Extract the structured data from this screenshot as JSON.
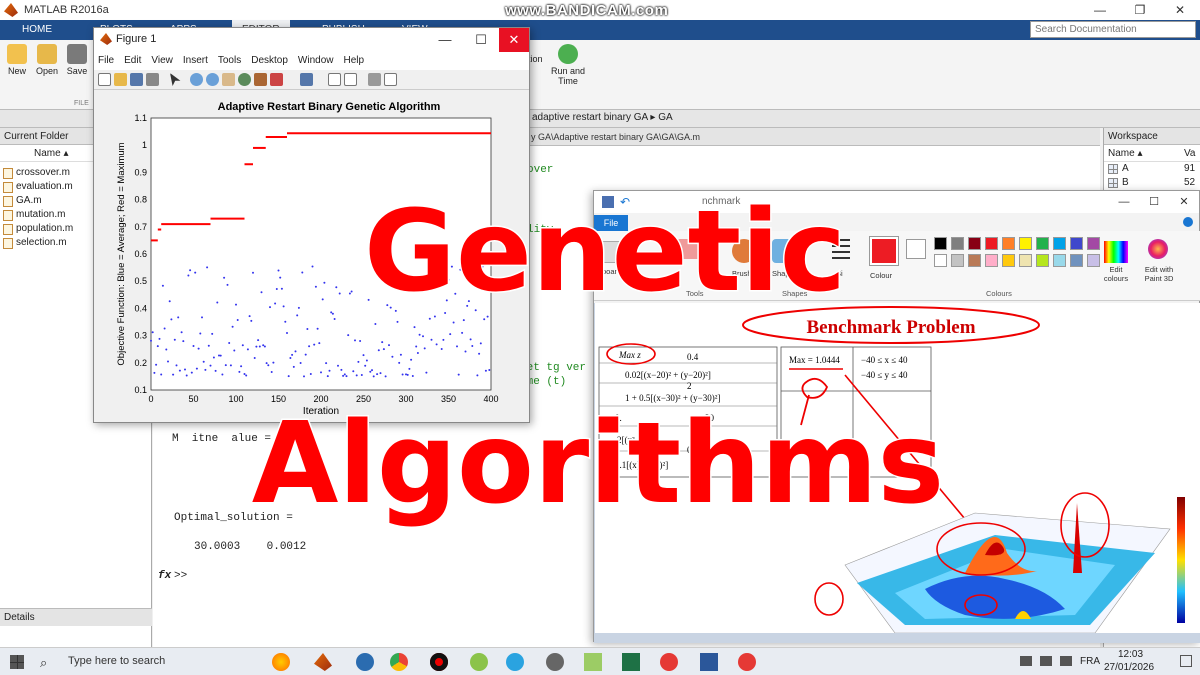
{
  "matlab": {
    "window_title": "MATLAB R2016a",
    "recorder_watermark": "www.BANDICAM.com",
    "tabs": [
      "HOME",
      "PLOTS",
      "APPS",
      "EDITOR",
      "PUBLISH",
      "VIEW"
    ],
    "search_placeholder": "Search Documentation",
    "ribbon": {
      "new": "New",
      "open": "Open",
      "save": "Save",
      "file_section": "FILE",
      "run_and_time": "Run and Time",
      "run_section": "tion"
    },
    "address_path": "adaptive restart binary GA ▸ GA",
    "editor_path": "y GA\\Adaptive restart binary GA\\GA\\GA.m",
    "current_folder": {
      "title": "Current Folder",
      "column": "Name ▴",
      "files": [
        "crossover.m",
        "evaluation.m",
        "GA.m",
        "mutation.m",
        "population.m",
        "selection.m"
      ],
      "details": "Details"
    },
    "workspace": {
      "title": "Workspace",
      "col_name": "Name ▴",
      "col_value": "Va",
      "rows": [
        {
          "name": "A",
          "value": "91"
        },
        {
          "name": "B",
          "value": "52"
        }
      ]
    },
    "command": {
      "line1": "over",
      "line2": "lity",
      "line3": "set tg ver",
      "line4": "ime (t)",
      "line5": "M  itne  alue =",
      "line6": "Optimal_solution =",
      "line7": "30.0003    0.0012",
      "prompt_fx": "fx",
      "prompt": ">>"
    }
  },
  "figure1": {
    "title": "Figure 1",
    "menu": [
      "File",
      "Edit",
      "View",
      "Insert",
      "Tools",
      "Desktop",
      "Window",
      "Help"
    ]
  },
  "chart_data": {
    "type": "scatter",
    "title": "Adaptive Restart Binary Genetic Algorithm",
    "xlabel": "Iteration",
    "ylabel": "Objective Function: Blue = Average; Red = Maximum",
    "xlim": [
      0,
      400
    ],
    "ylim": [
      0.1,
      1.1
    ],
    "x_ticks": [
      0,
      50,
      100,
      150,
      200,
      250,
      300,
      350,
      400
    ],
    "y_ticks": [
      0.1,
      0.2,
      0.3,
      0.4,
      0.5,
      0.6,
      0.7,
      0.8,
      0.9,
      1,
      1.1
    ],
    "series": [
      {
        "name": "Maximum",
        "color": "#ff0000",
        "segments": [
          {
            "x_from": 0,
            "x_to": 8,
            "y": 0.65
          },
          {
            "x_from": 8,
            "x_to": 12,
            "y": 0.69
          },
          {
            "x_from": 12,
            "x_to": 70,
            "y": 0.71
          },
          {
            "x_from": 70,
            "x_to": 110,
            "y": 0.73
          },
          {
            "x_from": 110,
            "x_to": 120,
            "y": 0.93
          },
          {
            "x_from": 120,
            "x_to": 135,
            "y": 0.99
          },
          {
            "x_from": 135,
            "x_to": 160,
            "y": 1.03
          },
          {
            "x_from": 160,
            "x_to": 400,
            "y": 1.044
          }
        ]
      },
      {
        "name": "Average",
        "color": "#3333ee",
        "y_range": [
          0.15,
          0.56
        ],
        "n_points": 400
      }
    ]
  },
  "overlay": {
    "title_line1": "Genetic",
    "title_line2": "Algorithms",
    "color": "#ff0000"
  },
  "paint": {
    "title": "nchmark",
    "file_tab": "File",
    "labels": {
      "clipboard": "board",
      "tools": "Tools",
      "brushes": "Brush",
      "shapes": "Shapes",
      "size": "Si",
      "colour1": "Colour",
      "colours": "Colours",
      "edit_colours": "Edit colours",
      "paint3d": "Edit with Paint 3D"
    },
    "palette": [
      "#000000",
      "#7f7f7f",
      "#880015",
      "#ed1c24",
      "#ff7f27",
      "#fff200",
      "#22b14c",
      "#00a2e8",
      "#3f48cc",
      "#a349a4",
      "#ffffff",
      "#c3c3c3",
      "#b97a57",
      "#ffaec9",
      "#ffc90e",
      "#efe4b0",
      "#b5e61d",
      "#99d9ea",
      "#7092be",
      "#c8bfe7"
    ],
    "benchmark": {
      "heading": "Benchmark Problem",
      "max_z": "Max z",
      "max_value": "Max = 1.0444",
      "constraint_x": "−40 ≤ x ≤ 40",
      "constraint_y": "−40 ≤ y ≤ 40",
      "f1": "0.4",
      "f2": "0.02[(x−20)² + (y−20)²]",
      "f3": "2",
      "f4": "1 + 0.5[(x−30)² + (y−30)²]",
      "f5": "0.",
      "f6": "30",
      "f7": "2[(x² + y²]",
      "f8": "05",
      "f9": "0.1[(x)² + (y)²]"
    }
  },
  "taskbar": {
    "search_placeholder": "Type here to search",
    "language": "FRA",
    "time": "12:03",
    "date": "27/01/2026"
  }
}
